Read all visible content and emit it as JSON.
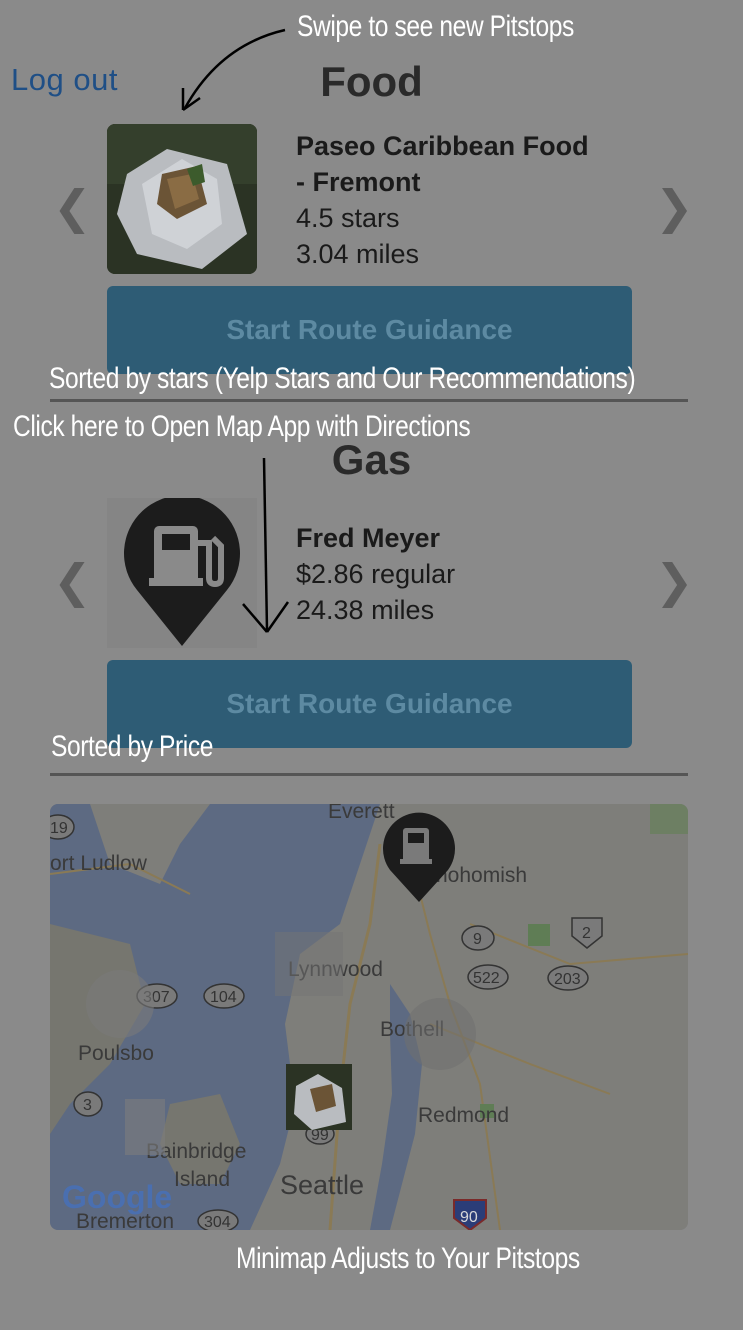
{
  "header": {
    "logout_label": "Log out"
  },
  "food": {
    "title": "Food",
    "name": "Paseo Caribbean Food - Fremont",
    "name_line1": "Paseo Caribbean Food",
    "name_line2": "- Fremont",
    "rating": "4.5 stars",
    "distance": "3.04 miles",
    "route_button": "Start Route Guidance",
    "prev_icon": "chevron-left-icon",
    "next_icon": "chevron-right-icon",
    "prev_glyph": "❮",
    "next_glyph": "❯"
  },
  "gas": {
    "title": "Gas",
    "name": "Fred Meyer",
    "price": "$2.86 regular",
    "distance": "24.38 miles",
    "route_button": "Start Route Guidance",
    "icon": "gas-station-pin-icon",
    "prev_glyph": "❮",
    "next_glyph": "❯"
  },
  "map": {
    "places": [
      "Everett",
      "ort Ludlow",
      "Snohomish",
      "Lynnwood",
      "Bothell",
      "Poulsbo",
      "Redmond",
      "Bainbridge",
      "Island",
      "Seattle",
      "Bremerton"
    ],
    "route_shields": [
      "19",
      "9",
      "2",
      "522",
      "203",
      "307",
      "104",
      "3",
      "99",
      "304",
      "90"
    ],
    "attribution": "Google"
  },
  "annotations": {
    "swipe": "Swipe  to see new Pitstops",
    "sorted_stars": "Sorted by stars (Yelp Stars and Our Recommendations)",
    "click_here": "Click here to Open Map App with Directions",
    "sorted_price": "Sorted by Price",
    "minimap": "Minimap Adjusts to Your Pitstops"
  },
  "colors": {
    "background": "#8a8a8a",
    "button": "#2e5c75",
    "button_text": "#5d8aa2",
    "logout": "#1f4f86",
    "annotation": "#ffffff"
  }
}
